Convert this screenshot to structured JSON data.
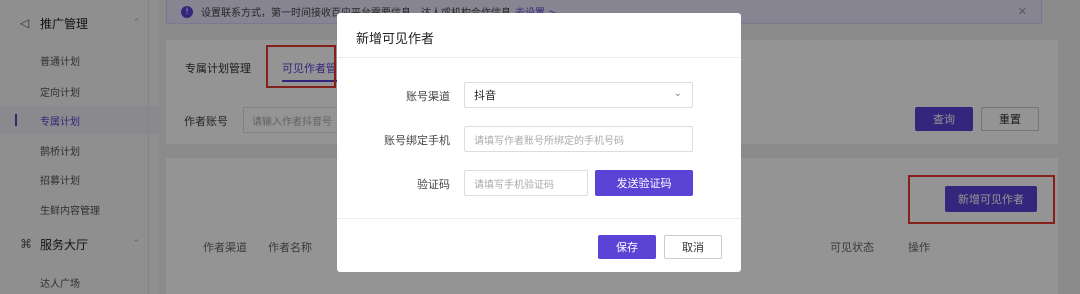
{
  "sidebar": {
    "group_promotion": {
      "label": "推广管理",
      "icon": "promotion-icon"
    },
    "items": [
      {
        "label": "普通计划"
      },
      {
        "label": "定向计划"
      },
      {
        "label": "专属计划"
      },
      {
        "label": "鹊桥计划"
      },
      {
        "label": "招募计划"
      },
      {
        "label": "生鲜内容管理"
      }
    ],
    "group_service": {
      "label": "服务大厅",
      "icon": "grid-icon"
    },
    "service_items": [
      {
        "label": "达人广场"
      }
    ]
  },
  "notice": {
    "text": "设置联系方式，第一时间接收百应平台需要信息、达人或机构合作信息",
    "link": "去设置 >"
  },
  "tabs": [
    {
      "label": "专属计划管理"
    },
    {
      "label": "可见作者管"
    }
  ],
  "filter": {
    "author_label": "作者账号",
    "author_placeholder": "请输入作者抖音号",
    "query_label": "查询",
    "reset_label": "重置"
  },
  "list": {
    "add_label": "新增可见作者",
    "columns": [
      "作者渠道",
      "作者名称",
      "可见状态",
      "操作"
    ]
  },
  "modal": {
    "title": "新增可见作者",
    "channel_label": "账号渠道",
    "channel_value": "抖音",
    "phone_label": "账号绑定手机",
    "phone_placeholder": "请填写作者账号所绑定的手机号码",
    "code_label": "验证码",
    "code_placeholder": "请填写手机验证码",
    "send_code_label": "发送验证码",
    "save_label": "保存",
    "cancel_label": "取消"
  },
  "colors": {
    "accent": "#5b43d6",
    "highlight": "#e63a2e"
  }
}
